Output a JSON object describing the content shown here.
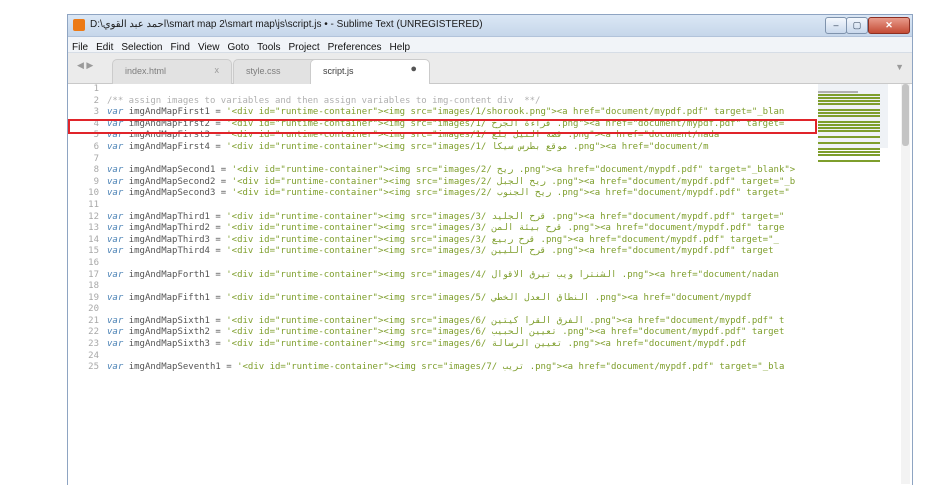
{
  "window": {
    "title": "D:\\احمد عبد القوي\\smart map 2\\smart map\\js\\script.js • - Sublime Text (UNREGISTERED)",
    "controls": {
      "minimize": "–",
      "maximize": "▢",
      "close": "✕"
    }
  },
  "menu": [
    "File",
    "Edit",
    "Selection",
    "Find",
    "View",
    "Goto",
    "Tools",
    "Project",
    "Preferences",
    "Help"
  ],
  "tabs": [
    {
      "label": "index.html",
      "close": "x",
      "active": false
    },
    {
      "label": "style.css",
      "close": "x",
      "active": false
    },
    {
      "label": "script.js",
      "close": "●",
      "active": true
    }
  ],
  "tabbar": {
    "nav": "◀ ▶",
    "dropdown": "▼"
  },
  "code": [
    {
      "n": "1",
      "kind": "blank"
    },
    {
      "n": "2",
      "kind": "comment",
      "text": "/** assign images to variables and then assign variables to img-content div  **/"
    },
    {
      "n": "3",
      "kind": "code",
      "name": "imgAndMapFirst1",
      "value": "'<div id=\"runtime-container\"><img src=\"images/1/shorook.png\"><a href=\"document/mypdf.pdf\" target=\"_blan"
    },
    {
      "n": "4",
      "kind": "code",
      "name": "imgAndMapFirst2",
      "value": "'<div id=\"runtime-container\"><img src=\"images/1/ قراءة الجرح .png\"><a href=\"document/mypdf.pdf\" target="
    },
    {
      "n": "5",
      "kind": "code",
      "name": "imgAndMapFirst3",
      "value": "'<div id=\"runtime-container\"><img src=\"images/1/ قصة النيل بلغ .png\"><a href=\"document/nada"
    },
    {
      "n": "6",
      "kind": "code",
      "name": "imgAndMapFirst4",
      "value": "'<div id=\"runtime-container\"><img src=\"images/1/ موقع بطرس سيكا .png\"><a href=\"document/m"
    },
    {
      "n": "7",
      "kind": "blank"
    },
    {
      "n": "8",
      "kind": "code",
      "name": "imgAndMapSecond1",
      "value": "'<div id=\"runtime-container\"><img src=\"images/2/ ريح .png\"><a href=\"document/mypdf.pdf\" target=\"_blank\">"
    },
    {
      "n": "9",
      "kind": "code",
      "name": "imgAndMapSecond2",
      "value": "'<div id=\"runtime-container\"><img src=\"images/2/ ريح الجبل .png\"><a href=\"document/mypdf.pdf\" target=\"_b"
    },
    {
      "n": "10",
      "kind": "code",
      "name": "imgAndMapSecond3",
      "value": "'<div id=\"runtime-container\"><img src=\"images/2/ ريح الجنوب .png\"><a href=\"document/mypdf.pdf\" target=\""
    },
    {
      "n": "11",
      "kind": "blank"
    },
    {
      "n": "12",
      "kind": "code",
      "name": "imgAndMapThird1",
      "value": "'<div id=\"runtime-container\"><img src=\"images/3/ قرح الجليد .png\"><a href=\"document/mypdf.pdf\" target=\""
    },
    {
      "n": "13",
      "kind": "code",
      "name": "imgAndMapThird2",
      "value": "'<div id=\"runtime-container\"><img src=\"images/3/ قرح بيئة المن .png\"><a href=\"document/mypdf.pdf\" targe"
    },
    {
      "n": "14",
      "kind": "code",
      "name": "imgAndMapThird3",
      "value": "'<div id=\"runtime-container\"><img src=\"images/3/ قرح ربيع .png\"><a href=\"document/mypdf.pdf\" target=\"_"
    },
    {
      "n": "15",
      "kind": "code",
      "name": "imgAndMapThird4",
      "value": "'<div id=\"runtime-container\"><img src=\"images/3/ قرح الليين .png\"><a href=\"document/mypdf.pdf\" target"
    },
    {
      "n": "16",
      "kind": "blank"
    },
    {
      "n": "17",
      "kind": "code",
      "name": "imgAndMapForth1",
      "value": "'<div id=\"runtime-container\"><img src=\"images/4/ الشنترا ويب تيرق الاقوال .png\"><a href=\"document/nadan"
    },
    {
      "n": "18",
      "kind": "blank"
    },
    {
      "n": "19",
      "kind": "code",
      "name": "imgAndMapFifth1",
      "value": "'<div id=\"runtime-container\"><img src=\"images/5/ النطاق العدل الخطي .png\"><a href=\"document/mypdf"
    },
    {
      "n": "20",
      "kind": "blank"
    },
    {
      "n": "21",
      "kind": "code",
      "name": "imgAndMapSixth1",
      "value": "'<div id=\"runtime-container\"><img src=\"images/6/ الفرق القرا كيتين .png\"><a href=\"document/mypdf.pdf\" t"
    },
    {
      "n": "22",
      "kind": "code",
      "name": "imgAndMapSixth2",
      "value": "'<div id=\"runtime-container\"><img src=\"images/6/ تعيين الحبيب .png\"><a href=\"document/mypdf.pdf\" target"
    },
    {
      "n": "23",
      "kind": "code",
      "name": "imgAndMapSixth3",
      "value": "'<div id=\"runtime-container\"><img src=\"images/6/ تعيين الرسالة .png\"><a href=\"document/mypdf.pdf"
    },
    {
      "n": "24",
      "kind": "blank"
    },
    {
      "n": "25",
      "kind": "code",
      "name": "imgAndMapSeventh1",
      "value": "'<div id=\"runtime-container\"><img src=\"images/7/ تريب .png\"><a href=\"document/mypdf.pdf\" target=\"_bla"
    }
  ],
  "syntax": {
    "keyword": "var",
    "assign": " = "
  },
  "colors": {
    "keyword": "#4b82b5",
    "string": "#7e9e2c",
    "comment": "#b0b0b0",
    "highlight_box": "#e0242a"
  }
}
